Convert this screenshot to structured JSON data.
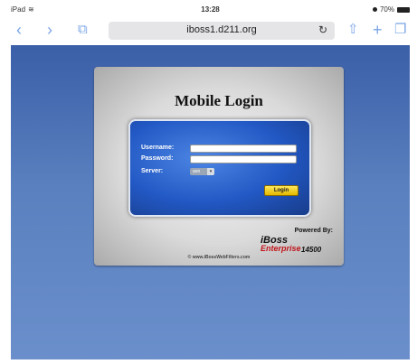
{
  "status_bar": {
    "device": "iPad",
    "time": "13:28",
    "battery": "70%"
  },
  "browser": {
    "url": "iboss1.d211.org",
    "icons": {
      "back": "chevron-left-icon",
      "forward": "chevron-right-icon",
      "bookmarks": "book-icon",
      "reload": "reload-icon",
      "share": "share-icon",
      "new_tab": "plus-icon",
      "tabs": "tabs-icon"
    }
  },
  "login": {
    "title": "Mobile Login",
    "username_label": "Username:",
    "password_label": "Password:",
    "server_label": "Server:",
    "server_value": "aon",
    "button_label": "Login"
  },
  "footer": {
    "powered_by": "Powered By:",
    "brand_name": "iBoss",
    "brand_edition": "Enterprise",
    "brand_model": "14500",
    "copyright": "© www.iBossWebFilters.com"
  },
  "colors": {
    "background_top": "#3b5fa8",
    "panel_blue": "#2258c4",
    "brand_red": "#c0151a",
    "login_button": "#f0cc1e"
  }
}
